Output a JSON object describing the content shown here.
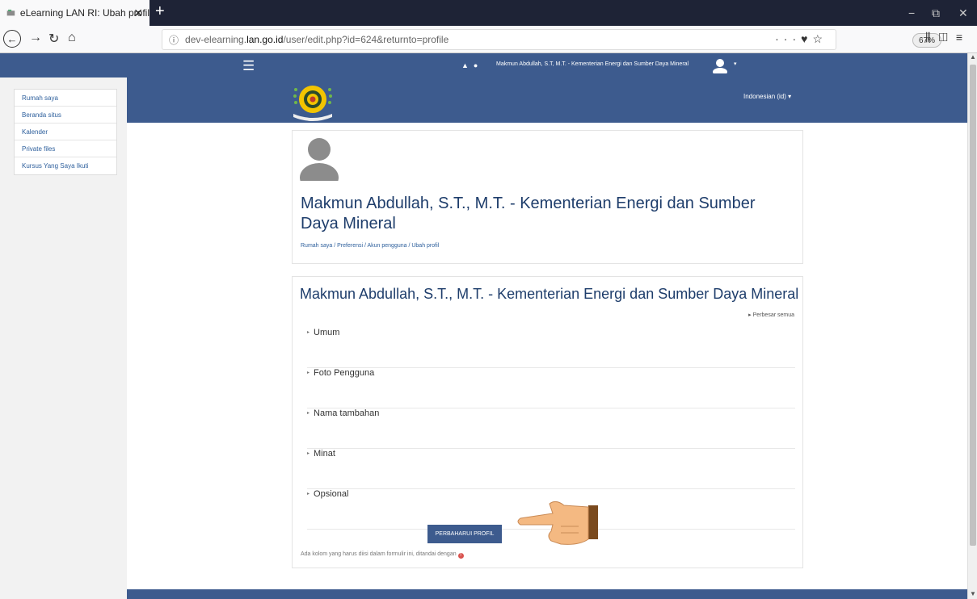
{
  "browser": {
    "tab_title": "eLearning LAN RI: Ubah profil",
    "tab_close": "✕",
    "new_tab": "+",
    "url_prefix": "dev-elearning.",
    "url_host": "lan.go.id",
    "url_path": "/user/edit.php?id=624&returnto=profile",
    "zoom": "67%",
    "window_controls": [
      "−",
      "⧉",
      "✕"
    ]
  },
  "topbar": {
    "user_name": "Makmun Abdullah, S.T, M.T. - Kementerian Energi dan Sumber Daya Mineral"
  },
  "leftnav": {
    "items": [
      "Rumah saya",
      "Beranda situs",
      "Kalender",
      "Private files",
      "Kursus Yang Saya Ikuti"
    ]
  },
  "banner": {
    "language": "Indonesian (id) ▾"
  },
  "profile": {
    "name": "Makmun Abdullah, S.T., M.T. - Kementerian Energi dan Sumber Daya Mineral",
    "breadcrumb": "Rumah saya  /  Preferensi  /  Akun pengguna  /  Ubah profil"
  },
  "form": {
    "title": "Makmun Abdullah, S.T., M.T. - Kementerian Energi dan Sumber Daya Mineral",
    "expand_all": "Perbesar semua",
    "sections": [
      "Umum",
      "Foto Pengguna",
      "Nama tambahan",
      "Minat",
      "Opsional"
    ],
    "submit_label": "PERBAHARUI PROFIL",
    "required_note": "Ada kolom yang harus diisi dalam formulir ini, ditandai dengan"
  },
  "colors": {
    "primary": "#3d5b8e",
    "heading": "#1e3d6b",
    "link": "#2d5f9c"
  }
}
